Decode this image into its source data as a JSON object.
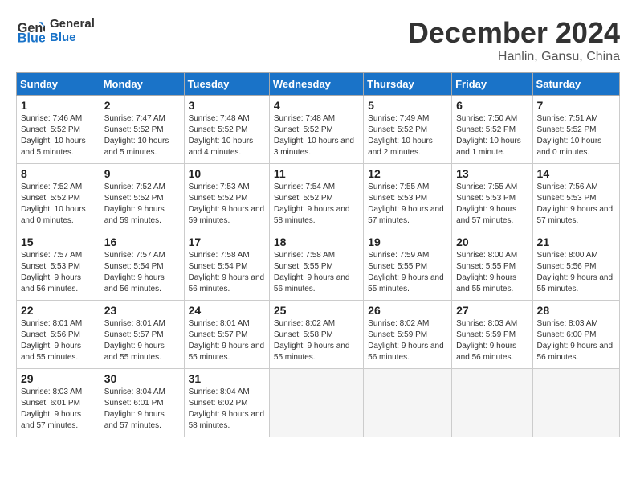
{
  "logo": {
    "line1": "General",
    "line2": "Blue"
  },
  "title": "December 2024",
  "subtitle": "Hanlin, Gansu, China",
  "days_of_week": [
    "Sunday",
    "Monday",
    "Tuesday",
    "Wednesday",
    "Thursday",
    "Friday",
    "Saturday"
  ],
  "weeks": [
    [
      {
        "day": 1,
        "sunrise": "7:46 AM",
        "sunset": "5:52 PM",
        "daylight": "10 hours and 5 minutes."
      },
      {
        "day": 2,
        "sunrise": "7:47 AM",
        "sunset": "5:52 PM",
        "daylight": "10 hours and 5 minutes."
      },
      {
        "day": 3,
        "sunrise": "7:48 AM",
        "sunset": "5:52 PM",
        "daylight": "10 hours and 4 minutes."
      },
      {
        "day": 4,
        "sunrise": "7:48 AM",
        "sunset": "5:52 PM",
        "daylight": "10 hours and 3 minutes."
      },
      {
        "day": 5,
        "sunrise": "7:49 AM",
        "sunset": "5:52 PM",
        "daylight": "10 hours and 2 minutes."
      },
      {
        "day": 6,
        "sunrise": "7:50 AM",
        "sunset": "5:52 PM",
        "daylight": "10 hours and 1 minute."
      },
      {
        "day": 7,
        "sunrise": "7:51 AM",
        "sunset": "5:52 PM",
        "daylight": "10 hours and 0 minutes."
      }
    ],
    [
      {
        "day": 8,
        "sunrise": "7:52 AM",
        "sunset": "5:52 PM",
        "daylight": "10 hours and 0 minutes."
      },
      {
        "day": 9,
        "sunrise": "7:52 AM",
        "sunset": "5:52 PM",
        "daylight": "9 hours and 59 minutes."
      },
      {
        "day": 10,
        "sunrise": "7:53 AM",
        "sunset": "5:52 PM",
        "daylight": "9 hours and 59 minutes."
      },
      {
        "day": 11,
        "sunrise": "7:54 AM",
        "sunset": "5:52 PM",
        "daylight": "9 hours and 58 minutes."
      },
      {
        "day": 12,
        "sunrise": "7:55 AM",
        "sunset": "5:53 PM",
        "daylight": "9 hours and 57 minutes."
      },
      {
        "day": 13,
        "sunrise": "7:55 AM",
        "sunset": "5:53 PM",
        "daylight": "9 hours and 57 minutes."
      },
      {
        "day": 14,
        "sunrise": "7:56 AM",
        "sunset": "5:53 PM",
        "daylight": "9 hours and 57 minutes."
      }
    ],
    [
      {
        "day": 15,
        "sunrise": "7:57 AM",
        "sunset": "5:53 PM",
        "daylight": "9 hours and 56 minutes."
      },
      {
        "day": 16,
        "sunrise": "7:57 AM",
        "sunset": "5:54 PM",
        "daylight": "9 hours and 56 minutes."
      },
      {
        "day": 17,
        "sunrise": "7:58 AM",
        "sunset": "5:54 PM",
        "daylight": "9 hours and 56 minutes."
      },
      {
        "day": 18,
        "sunrise": "7:58 AM",
        "sunset": "5:55 PM",
        "daylight": "9 hours and 56 minutes."
      },
      {
        "day": 19,
        "sunrise": "7:59 AM",
        "sunset": "5:55 PM",
        "daylight": "9 hours and 55 minutes."
      },
      {
        "day": 20,
        "sunrise": "8:00 AM",
        "sunset": "5:55 PM",
        "daylight": "9 hours and 55 minutes."
      },
      {
        "day": 21,
        "sunrise": "8:00 AM",
        "sunset": "5:56 PM",
        "daylight": "9 hours and 55 minutes."
      }
    ],
    [
      {
        "day": 22,
        "sunrise": "8:01 AM",
        "sunset": "5:56 PM",
        "daylight": "9 hours and 55 minutes."
      },
      {
        "day": 23,
        "sunrise": "8:01 AM",
        "sunset": "5:57 PM",
        "daylight": "9 hours and 55 minutes."
      },
      {
        "day": 24,
        "sunrise": "8:01 AM",
        "sunset": "5:57 PM",
        "daylight": "9 hours and 55 minutes."
      },
      {
        "day": 25,
        "sunrise": "8:02 AM",
        "sunset": "5:58 PM",
        "daylight": "9 hours and 55 minutes."
      },
      {
        "day": 26,
        "sunrise": "8:02 AM",
        "sunset": "5:59 PM",
        "daylight": "9 hours and 56 minutes."
      },
      {
        "day": 27,
        "sunrise": "8:03 AM",
        "sunset": "5:59 PM",
        "daylight": "9 hours and 56 minutes."
      },
      {
        "day": 28,
        "sunrise": "8:03 AM",
        "sunset": "6:00 PM",
        "daylight": "9 hours and 56 minutes."
      }
    ],
    [
      {
        "day": 29,
        "sunrise": "8:03 AM",
        "sunset": "6:01 PM",
        "daylight": "9 hours and 57 minutes."
      },
      {
        "day": 30,
        "sunrise": "8:04 AM",
        "sunset": "6:01 PM",
        "daylight": "9 hours and 57 minutes."
      },
      {
        "day": 31,
        "sunrise": "8:04 AM",
        "sunset": "6:02 PM",
        "daylight": "9 hours and 58 minutes."
      },
      null,
      null,
      null,
      null
    ]
  ]
}
